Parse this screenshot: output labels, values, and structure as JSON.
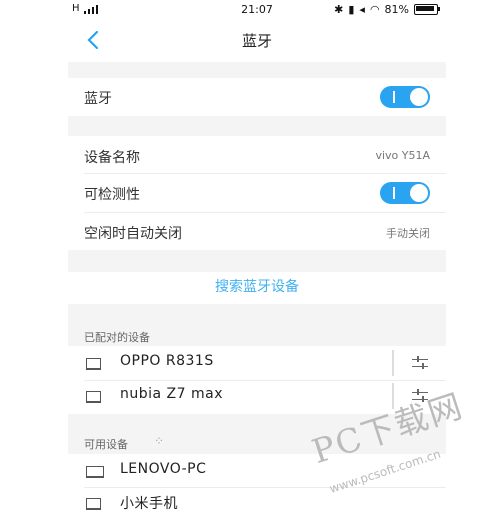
{
  "status_bar": {
    "network": "H",
    "time": "21:07",
    "battery": "81%"
  },
  "nav": {
    "title": "蓝牙"
  },
  "bluetooth": {
    "label": "蓝牙",
    "enabled": true
  },
  "device_name": {
    "label": "设备名称",
    "value": "vivo Y51A"
  },
  "visibility": {
    "label": "可检测性",
    "enabled": true
  },
  "idle_off": {
    "label": "空闲时自动关闭",
    "value": "手动关闭"
  },
  "search_label": "搜索蓝牙设备",
  "paired": {
    "header": "已配对的设备",
    "devices": [
      {
        "name": "OPPO R831S"
      },
      {
        "name": "nubia Z7 max"
      }
    ]
  },
  "available": {
    "header": "可用设备",
    "devices": [
      {
        "name": "LENOVO-PC"
      },
      {
        "name": "小米手机"
      }
    ]
  },
  "watermark": {
    "big": "PC下载网",
    "small": "www.pcsoft.com.cn"
  },
  "colors": {
    "accent": "#2aa3f0",
    "link": "#3eb1f2",
    "section_bg": "#f4f4f4"
  }
}
